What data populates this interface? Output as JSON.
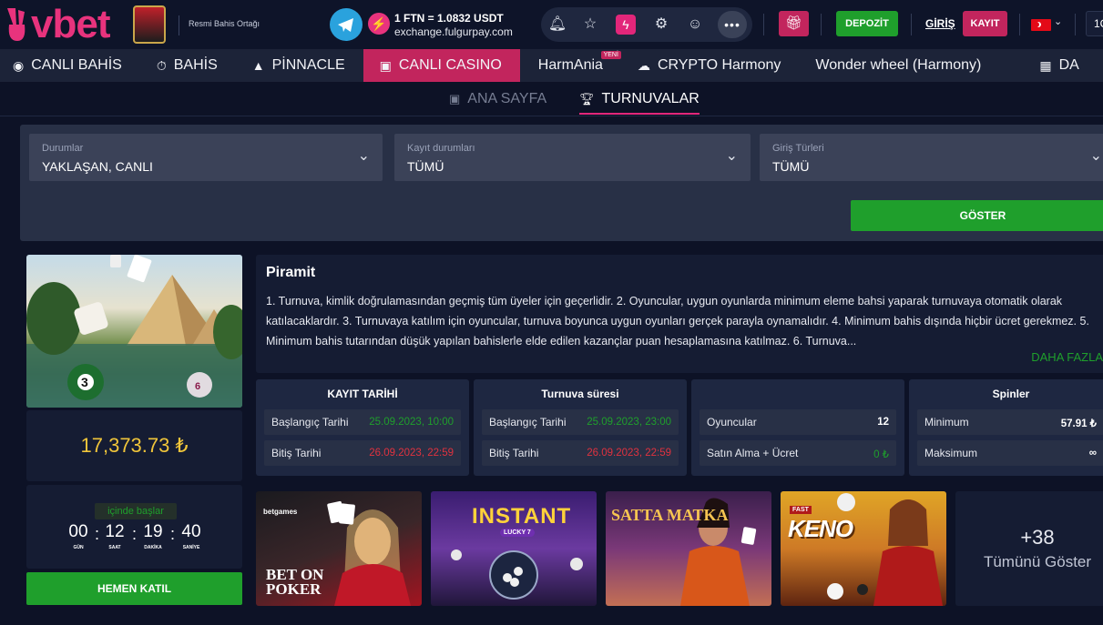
{
  "header": {
    "logo_text": "vbet",
    "partner_text": "Resmi Bahis Ortağı",
    "ftn_rate": "1 FTN = 1.0832 USDT",
    "ftn_site": "exchange.fulgurpay.com",
    "deposit_label": "DEPOZİT",
    "login_label": "GİRİŞ",
    "register_label": "KAYIT",
    "time_partial": "1C",
    "icons": [
      "telegram-icon",
      "ftn-icon",
      "bell-icon",
      "star-icon",
      "flash-icon",
      "gear-icon",
      "support-icon",
      "more-icon",
      "gift-icon"
    ]
  },
  "nav": {
    "items": [
      {
        "label": "CANLI BAHİS",
        "icon": "live-icon"
      },
      {
        "label": "BAHİS",
        "icon": "stopwatch-icon"
      },
      {
        "label": "PİNNACLE",
        "icon": "pinnacle-icon"
      },
      {
        "label": "CANLI CASINO",
        "icon": "casino-icon",
        "active": true
      },
      {
        "label": "HarmAnia",
        "badge": "YENİ"
      },
      {
        "label": "CRYPTO Harmony",
        "icon": "crypto-icon"
      },
      {
        "label": "Wonder wheel (Harmony)"
      },
      {
        "label": "DA",
        "icon": "grid-icon"
      }
    ]
  },
  "subnav": {
    "home_label": "ANA SAYFA",
    "tournaments_label": "TURNUVALAR"
  },
  "filters": {
    "status": {
      "label": "Durumlar",
      "value": "YAKLAŞAN, CANLI"
    },
    "registration": {
      "label": "Kayıt durumları",
      "value": "TÜMÜ"
    },
    "entry": {
      "label": "Giriş Türleri",
      "value": "TÜMÜ"
    },
    "show_label": "GÖSTER"
  },
  "tournament": {
    "prize": "17,373.73 ₺",
    "starts_label": "içinde başlar",
    "countdown": [
      {
        "value": "00",
        "unit": "GÜN"
      },
      {
        "value": "12",
        "unit": "SAAT"
      },
      {
        "value": "19",
        "unit": "DAKİKA"
      },
      {
        "value": "40",
        "unit": "SANİYE"
      }
    ],
    "join_label": "HEMEN KATIL",
    "title": "Piramit",
    "description": "1. Turnuva, kimlik doğrulamasından geçmiş tüm üyeler için geçerlidir. 2. Oyuncular, uygun oyunlarda minimum eleme bahsi yaparak turnuvaya otomatik olarak katılacaklardır. 3. Turnuvaya katılım için oyuncular, turnuva boyunca uygun oyunları gerçek parayla oynamalıdır. 4. Minimum bahis dışında hiçbir ücret gerekmez. 5. Minimum bahis tutarından düşük yapılan bahislerle elde edilen kazançlar puan hesaplamasına katılmaz. 6. Turnuva...",
    "more_label": "DAHA FAZLA",
    "registration_card": {
      "title": "KAYIT TARİHİ",
      "start_label": "Başlangıç Tarihi",
      "start_value": "25.09.2023, 10:00",
      "end_label": "Bitiş Tarihi",
      "end_value": "26.09.2023, 22:59"
    },
    "duration_card": {
      "title": "Turnuva süresi",
      "start_label": "Başlangıç Tarihi",
      "start_value": "25.09.2023, 23:00",
      "end_label": "Bitiş Tarihi",
      "end_value": "26.09.2023, 22:59"
    },
    "players_card": {
      "players_label": "Oyuncular",
      "players_value": "12",
      "buyin_label": "Satın Alma + Ücret",
      "buyin_value": "0 ₺"
    },
    "spins_card": {
      "title": "Spinler",
      "min_label": "Minimum",
      "min_value": "57.91 ₺",
      "max_label": "Maksimum",
      "max_value": "∞"
    }
  },
  "games": [
    {
      "brand": "betgames",
      "title": "BET ON POKER"
    },
    {
      "title": "INSTANT",
      "subtitle": "LUCKY 7"
    },
    {
      "title": "SATTA MATKA"
    },
    {
      "title": "KENO",
      "badge": "FAST"
    }
  ],
  "more_games": {
    "count": "+38",
    "label": "Tümünü Göster"
  },
  "colors": {
    "accent": "#c2255d",
    "green": "#1f9f2c",
    "red": "#e0323f",
    "gold": "#f0c53a",
    "bg": "#0d1226"
  }
}
